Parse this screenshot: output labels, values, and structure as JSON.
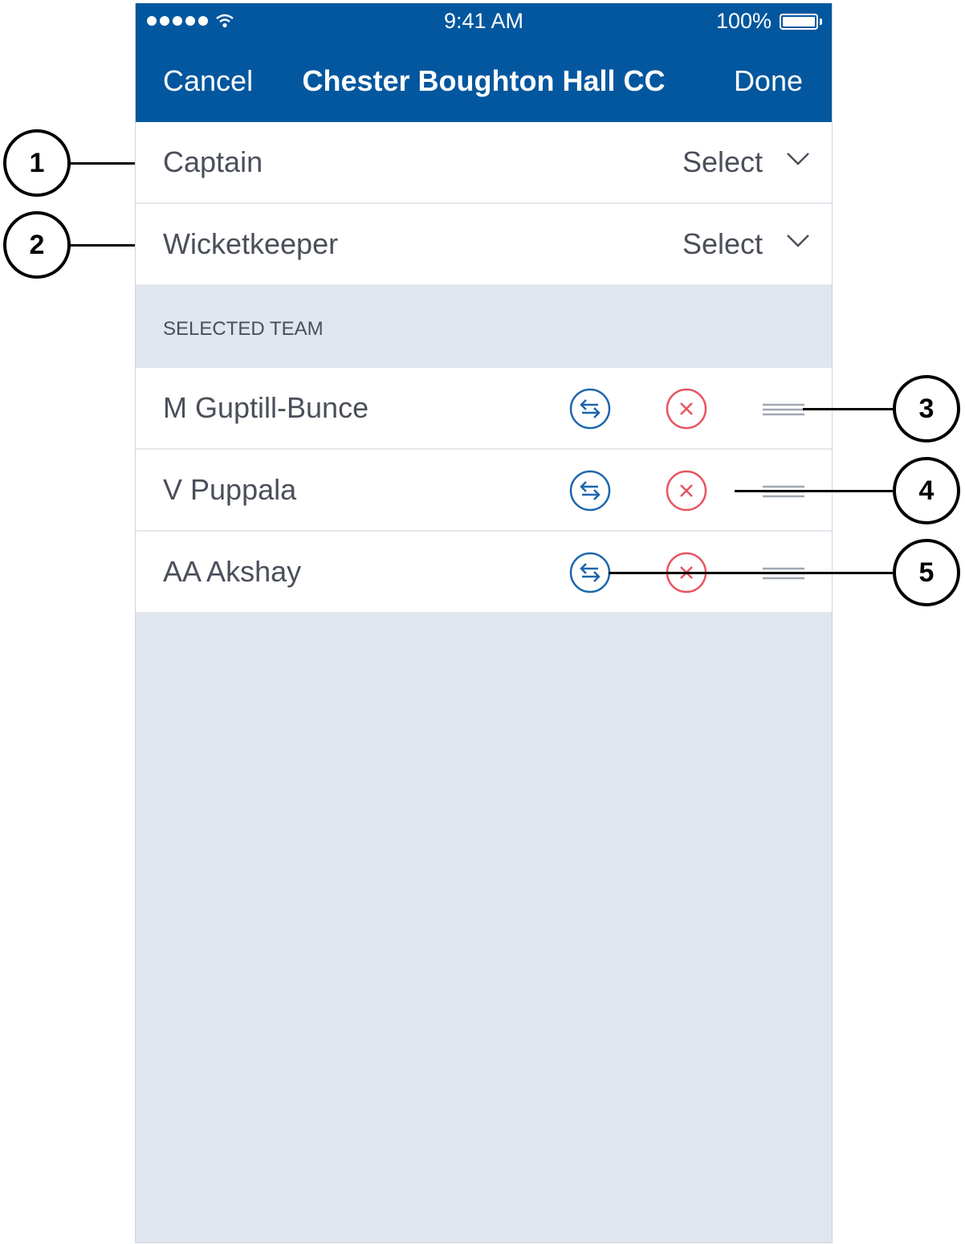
{
  "status_bar": {
    "time": "9:41 AM",
    "battery": "100%"
  },
  "nav": {
    "cancel_label": "Cancel",
    "title": "Chester Boughton Hall CC",
    "done_label": "Done"
  },
  "fields": [
    {
      "label": "Captain",
      "value": "Select"
    },
    {
      "label": "Wicketkeeper",
      "value": "Select"
    }
  ],
  "section": {
    "label": "SELECTED TEAM"
  },
  "players": [
    {
      "name": "M Guptill-Bunce"
    },
    {
      "name": "V Puppala"
    },
    {
      "name": "AA Akshay"
    }
  ],
  "callouts": [
    "1",
    "2",
    "3",
    "4",
    "5"
  ],
  "colors": {
    "nav_bg": "#03579e",
    "swap": "#1b67ad",
    "remove": "#e8535f",
    "list_bg": "#e1e5ee"
  }
}
